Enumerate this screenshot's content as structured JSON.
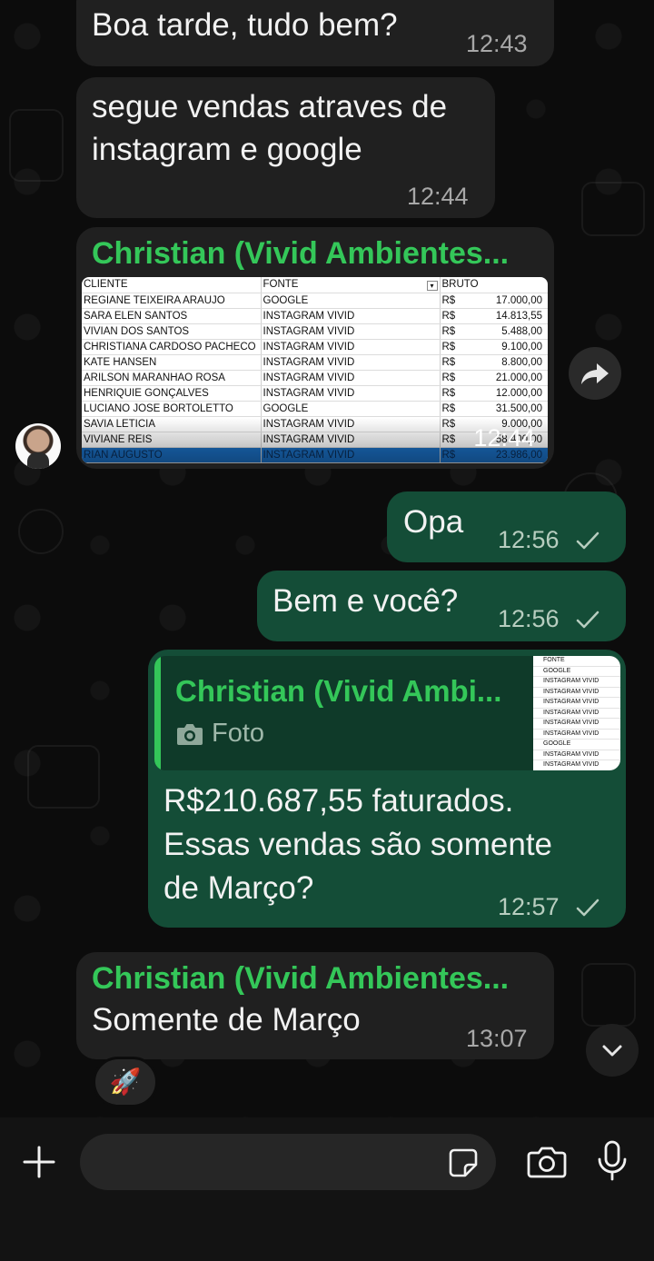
{
  "messages": {
    "m1": {
      "text": "Boa tarde, tudo bem?",
      "time": "12:43"
    },
    "m2": {
      "line1": "segue vendas atraves de",
      "line2": "instagram e google",
      "time": "12:44"
    },
    "m3": {
      "sender": "Christian (Vivid Ambientes...",
      "time": "12:44"
    },
    "m4": {
      "text": "Opa",
      "time": "12:56"
    },
    "m5": {
      "text": "Bem e você?",
      "time": "12:56"
    },
    "m6": {
      "quote_sender": "Christian (Vivid Ambi...",
      "quote_label": "Foto",
      "line1": "R$210.687,55 faturados.",
      "line2": "Essas vendas são somente",
      "line3": "de Março?",
      "time": "12:57"
    },
    "m7": {
      "sender": "Christian (Vivid Ambientes...",
      "text": "Somente de Março",
      "time": "13:07",
      "reaction": "🚀"
    }
  },
  "sheet": {
    "headers": [
      "CLIENTE",
      "FONTE",
      "BRUTO"
    ],
    "rows": [
      [
        "REGIANE TEIXEIRA ARAUJO",
        "GOOGLE",
        "R$",
        "17.000,00"
      ],
      [
        "SARA ELEN SANTOS",
        "INSTAGRAM VIVID",
        "R$",
        "14.813,55"
      ],
      [
        "VIVIAN DOS SANTOS",
        "INSTAGRAM VIVID",
        "R$",
        "5.488,00"
      ],
      [
        "CHRISTIANA CARDOSO PACHECO",
        "INSTAGRAM VIVID",
        "R$",
        "9.100,00"
      ],
      [
        "KATE HANSEN",
        "INSTAGRAM VIVID",
        "R$",
        "8.800,00"
      ],
      [
        "ARILSON MARANHAO ROSA",
        "INSTAGRAM VIVID",
        "R$",
        "21.000,00"
      ],
      [
        "HENRIQUIE GONÇALVES",
        "INSTAGRAM VIVID",
        "R$",
        "12.000,00"
      ],
      [
        "LUCIANO JOSE BORTOLETTO",
        "GOOGLE",
        "R$",
        "31.500,00"
      ],
      [
        "SAVIA LETICIA",
        "INSTAGRAM VIVID",
        "R$",
        "9.000,00"
      ],
      [
        "VIVIANE REIS",
        "INSTAGRAM VIVID",
        "R$",
        "58.400,00"
      ],
      [
        "RIAN AUGUSTO",
        "INSTAGRAM VIVID",
        "R$",
        "23.986,00"
      ]
    ]
  },
  "thumb_rows": [
    "FONTE",
    "GOOGLE",
    "INSTAGRAM VIVID",
    "INSTAGRAM VIVID",
    "INSTAGRAM VIVID",
    "INSTAGRAM VIVID",
    "INSTAGRAM VIVID",
    "INSTAGRAM VIVID",
    "GOOGLE",
    "INSTAGRAM VIVID",
    "INSTAGRAM VIVID",
    "INSTAGRAM VIVID"
  ],
  "icons": {
    "forward": "forward-icon",
    "scroll_down": "chevron-down-icon",
    "add": "plus-icon",
    "sticker": "sticker-icon",
    "camera": "camera-icon",
    "mic": "microphone-icon"
  },
  "colors": {
    "accent": "#34c759",
    "outgoing": "#144d37",
    "incoming": "#202020"
  }
}
